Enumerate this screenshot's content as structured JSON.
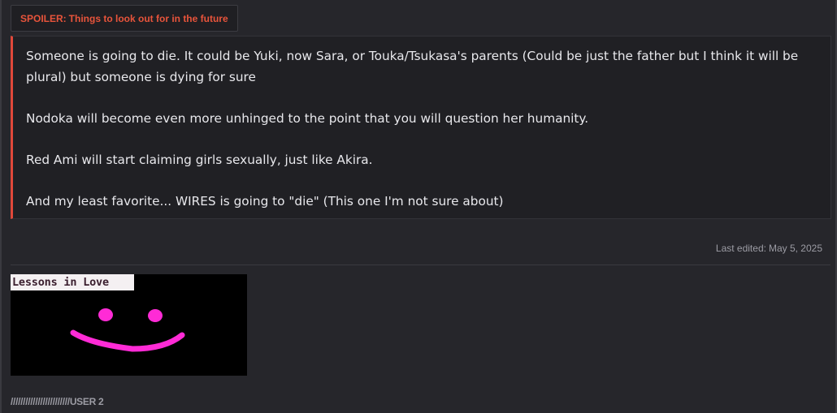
{
  "spoiler": {
    "prefix": "SPOILER:",
    "title": "Things to look out for in the future",
    "paragraphs": [
      "Someone is going to die. It could be Yuki, now Sara, or Touka/Tsukasa's parents (Could be just the father but I think it will be plural) but someone is dying for sure",
      "Nodoka will become even more unhinged to the point that you will question her humanity.",
      "Red Ami will start claiming girls sexually, just like Akira.",
      "And my least favorite... WIRES is going to \"die\" (This one I'm not sure about)"
    ]
  },
  "post": {
    "last_edited_label": "Last edited:",
    "last_edited_date": "May 5, 2025"
  },
  "signature": {
    "image_banner_text": "Lessons in Love",
    "text": "////////////////////////USER 2"
  },
  "colors": {
    "background": "#26262b",
    "spoiler_accent": "#e0483a",
    "smiley": "#ff2bd6"
  }
}
